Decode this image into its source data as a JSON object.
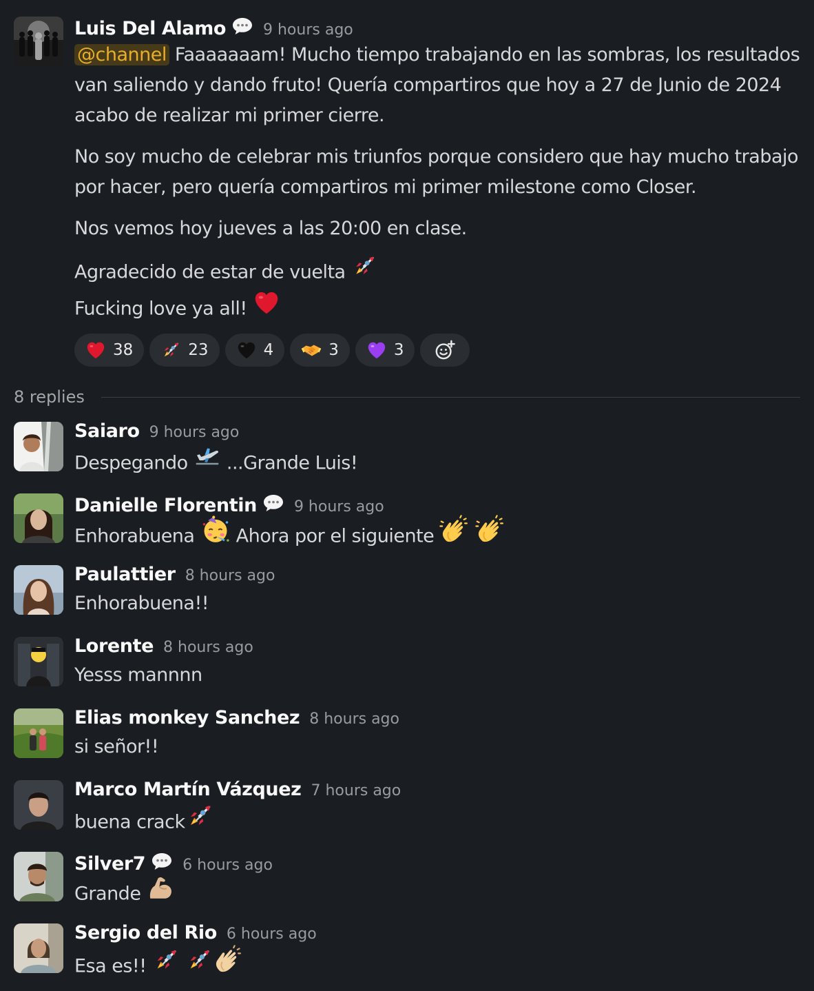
{
  "main_post": {
    "author": "Luis Del Alamo",
    "time": "9 hours ago",
    "mention": "@channel",
    "line1": " Faaaaaaam! Mucho tiempo trabajando en las sombras, los resultados",
    "line2": "van saliendo y dando fruto! Quería compartiros que hoy a 27 de Junio de 2024",
    "line3": "acabo de realizar mi primer cierre.",
    "line4": "No soy mucho de celebrar mis triunfos porque considero que hay mucho trabajo",
    "line5": "por hacer, pero quería compartiros mi primer milestone como Closer.",
    "line6": "Nos vemos hoy jueves a las 20:00 en clase.",
    "line7": "Agradecido de estar de vuelta",
    "line8": "Fucking love ya all!"
  },
  "reactions": [
    {
      "icon": "red-heart",
      "count": "38"
    },
    {
      "icon": "rocket",
      "count": "23"
    },
    {
      "icon": "black-heart",
      "count": "4"
    },
    {
      "icon": "handshake",
      "count": "3"
    },
    {
      "icon": "purple-heart",
      "count": "3"
    }
  ],
  "replies_label": "8 replies",
  "replies": [
    {
      "author": "Saiaro",
      "time": "9 hours ago",
      "text_a": "Despegando",
      "text_b": " ...Grande Luis!"
    },
    {
      "author": "Danielle Florentin",
      "time": "9 hours ago",
      "text_a": "Enhorabuena",
      "text_b": " Ahora por el siguiente"
    },
    {
      "author": "Paulattier",
      "time": "8 hours ago",
      "text_a": "Enhorabuena!!"
    },
    {
      "author": "Lorente",
      "time": "8 hours ago",
      "text_a": "Yesss mannnn"
    },
    {
      "author": "Elias monkey Sanchez",
      "time": "8 hours ago",
      "text_a": "si señor!!"
    },
    {
      "author": "Marco Martín Vázquez",
      "time": "7 hours ago",
      "text_a": "buena crack"
    },
    {
      "author": "Silver7",
      "time": "6 hours ago",
      "text_a": "Grande"
    },
    {
      "author": "Sergio del Rio",
      "time": "6 hours ago",
      "text_a": "Esa es!!"
    }
  ],
  "colors": {
    "background": "#1a1d21",
    "mention_bg": "#463a19",
    "mention_fg": "#e8ad2a",
    "reaction_bg": "#2a2d31"
  }
}
